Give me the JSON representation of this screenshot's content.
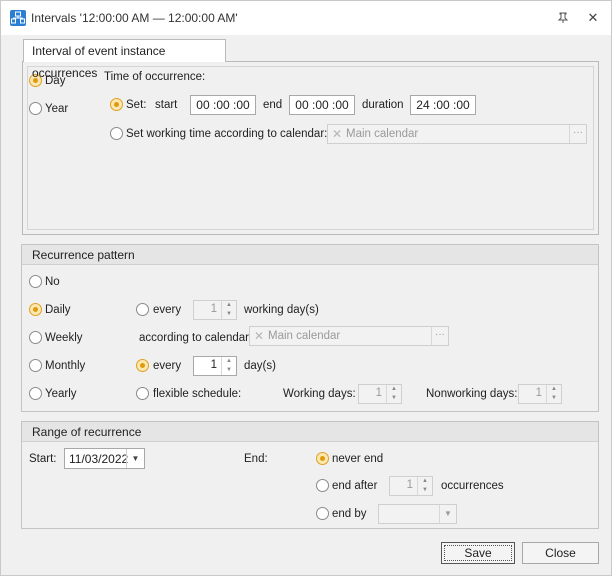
{
  "window": {
    "title": "Intervals '12:00:00 AM — 12:00:00 AM'",
    "app_icon": "schedule-icon",
    "pin_icon": "pin-icon",
    "close_icon": "close-icon"
  },
  "colors": {
    "radio_checked": "#e09a10",
    "panel_bg": "#f0f0f0",
    "header_bg": "#e5e5e5"
  },
  "occurrence": {
    "tab_label": "Interval of event instance occurrences",
    "day_label": "Day",
    "year_label": "Year",
    "day_selected": true,
    "time_label": "Time of occurrence:",
    "set_label": "Set:",
    "start_label": "start",
    "start_value": "00 :00 :00",
    "end_label": "end",
    "end_value": "00 :00 :00",
    "duration_label": "duration",
    "duration_value": "24 :00 :00",
    "calendar_option_label": "Set working time according to calendar:",
    "calendar_value": "Main calendar"
  },
  "recurrence": {
    "header": "Recurrence pattern",
    "no_label": "No",
    "daily_label": "Daily",
    "weekly_label": "Weekly",
    "monthly_label": "Monthly",
    "yearly_label": "Yearly",
    "selected": "Daily",
    "every_label_1": "every",
    "every_working_value": "1",
    "working_days_suffix": "working day(s)",
    "according_label": "according to calendar",
    "calendar_value": "Main calendar",
    "every_label_2": "every",
    "every_days_value": "1",
    "days_suffix": "day(s)",
    "flexible_label": "flexible schedule:",
    "working_days_label": "Working days:",
    "working_days_value": "1",
    "nonworking_days_label": "Nonworking days:",
    "nonworking_days_value": "1"
  },
  "range": {
    "header": "Range of recurrence",
    "start_label": "Start:",
    "start_value": "11/03/2022",
    "end_label": "End:",
    "never_end_label": "never end",
    "end_after_label": "end after",
    "end_after_value": "1",
    "occurrences_label": "occurrences",
    "end_by_label": "end by",
    "end_selected": "never end"
  },
  "buttons": {
    "save": "Save",
    "close": "Close"
  }
}
